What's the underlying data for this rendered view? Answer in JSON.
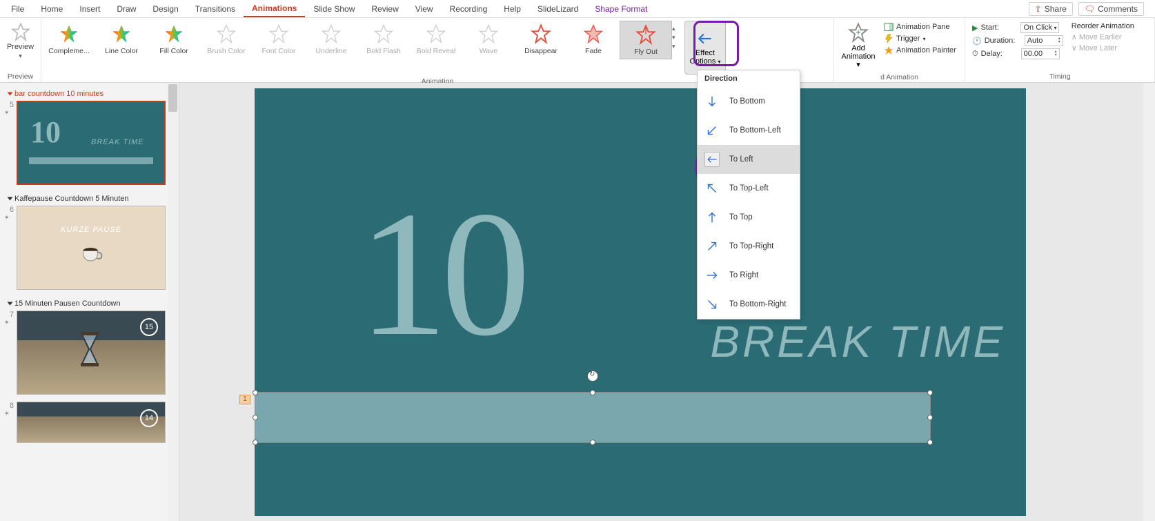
{
  "tabs": {
    "file": "File",
    "home": "Home",
    "insert": "Insert",
    "draw": "Draw",
    "design": "Design",
    "transitions": "Transitions",
    "animations": "Animations",
    "slideshow": "Slide Show",
    "review": "Review",
    "view": "View",
    "recording": "Recording",
    "help": "Help",
    "slidelizard": "SlideLizard",
    "shapeformat": "Shape Format"
  },
  "topright": {
    "share": "Share",
    "comments": "Comments"
  },
  "ribbon": {
    "preview": {
      "label": "Preview",
      "group": "Preview"
    },
    "animation_group": "Animation",
    "gallery": {
      "compl": "Compleme...",
      "linecolor": "Line Color",
      "fillcolor": "Fill Color",
      "brushcolor": "Brush Color",
      "fontcolor": "Font Color",
      "underline": "Underline",
      "boldflash": "Bold Flash",
      "boldreveal": "Bold Reveal",
      "wave": "Wave",
      "disappear": "Disappear",
      "fade": "Fade",
      "flyout": "Fly Out"
    },
    "effect_options": {
      "line1": "Effect",
      "line2": "Options"
    },
    "add_anim": {
      "line1": "Add",
      "line2": "Animation"
    },
    "advanced_group": "d Animation",
    "adv": {
      "pane": "Animation Pane",
      "trigger": "Trigger",
      "painter": "Animation Painter"
    },
    "timing_group": "Timing",
    "timing": {
      "start_lbl": "Start:",
      "start_val": "On Click",
      "duration_lbl": "Duration:",
      "duration_val": "Auto",
      "delay_lbl": "Delay:",
      "delay_val": "00.00"
    },
    "reorder": {
      "title": "Reorder Animation",
      "earlier": "Move Earlier",
      "later": "Move Later"
    }
  },
  "direction_menu": {
    "header": "Direction",
    "items": {
      "bottom": "To Bottom",
      "bottomleft": "To Bottom-Left",
      "left": "To Left",
      "topleft": "To Top-Left",
      "top": "To Top",
      "topright": "To Top-Right",
      "right": "To Right",
      "bottomright": "To Bottom-Right"
    }
  },
  "sections": {
    "s1": "bar countdown 10 minutes",
    "s2": "Kaffepause Countdown 5 Minuten",
    "s3": "15 Minuten Pausen Countdown"
  },
  "slides": {
    "n5": "5",
    "n6": "6",
    "n7": "7",
    "n8": "8",
    "badge15": "15",
    "badge14": "14",
    "thumb_big": "10",
    "thumb_break": "BREAK TIME",
    "kurze": "KURZE PAUSE"
  },
  "canvas": {
    "big10": "10",
    "break": "BREAK TIME",
    "anim_tag": "1"
  }
}
